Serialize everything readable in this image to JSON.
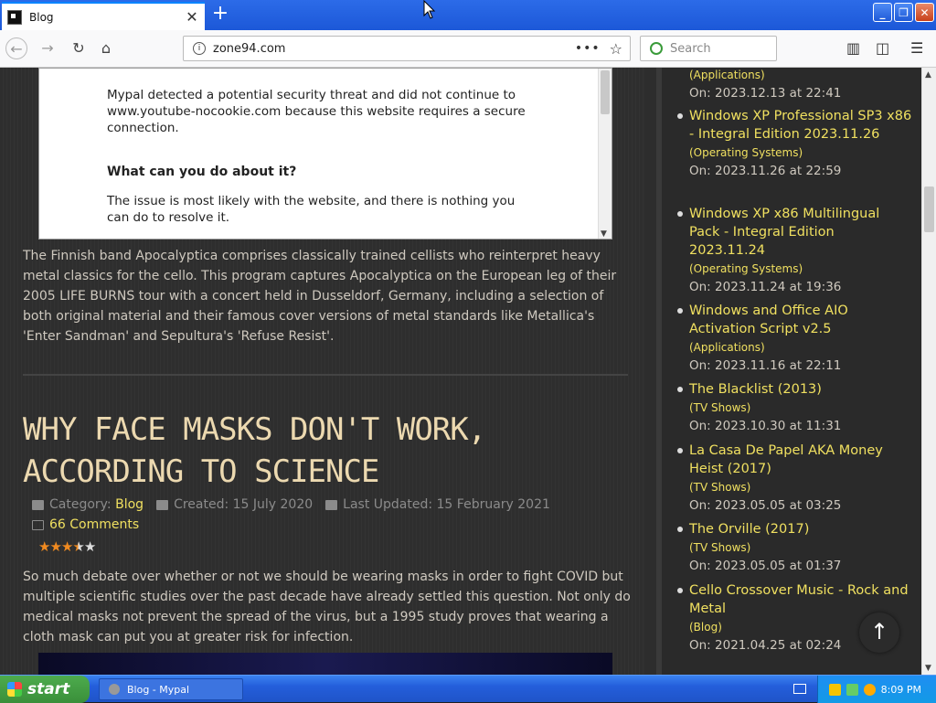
{
  "browser": {
    "tab_title": "Blog",
    "url": "zone94.com",
    "search_placeholder": "Search"
  },
  "frame": {
    "line1": "Mypal detected a potential security threat and did not continue to www.youtube-nocookie.com because this website requires a secure connection.",
    "heading": "What can you do about it?",
    "line2": "The issue is most likely with the website, and there is nothing you can do to resolve it."
  },
  "article1": {
    "body": "The Finnish band Apocalyptica comprises classically trained cellists who reinterpret heavy metal classics for the cello. This program captures Apocalyptica on the European leg of their 2005 LIFE BURNS tour with a concert held in Dusseldorf, Germany, including a selection of both original material and their famous cover versions of metal standards like Metallica's 'Enter Sandman' and Sepultura's 'Refuse Resist'."
  },
  "article2": {
    "title": "Why Face Masks Don't Work, According to Science",
    "category_label": "Category:",
    "category": "Blog",
    "created": "Created: 15 July 2020",
    "updated": "Last Updated: 15 February 2021",
    "comments": "66 Comments",
    "rating": 3.5,
    "body": "So much debate over whether or not we should be wearing masks in order to fight COVID but multiple scientific studies over the past decade have already settled this question. Not only do medical masks not prevent the spread of the virus, but a 1995 study proves that wearing a cloth mask can put you at greater risk for infection."
  },
  "sidebar": {
    "top_cat": "(Applications)",
    "top_date": "On: 2023.12.13 at 22:41",
    "items": [
      {
        "title": "Windows XP Professional SP3 x86 - Integral Edition 2023.11.26",
        "cat": "(Operating Systems)",
        "date": "On: 2023.11.26 at 22:59"
      },
      {
        "title": "Windows XP x86 Multilingual Pack - Integral Edition 2023.11.24",
        "cat": "(Operating Systems)",
        "date": "On: 2023.11.24 at 19:36"
      },
      {
        "title": "Windows and Office AIO Activation Script v2.5",
        "cat": "(Applications)",
        "date": "On: 2023.11.16 at 22:11"
      },
      {
        "title": "The Blacklist (2013)",
        "cat": "(TV Shows)",
        "date": "On: 2023.10.30 at 11:31"
      },
      {
        "title": "La Casa De Papel AKA Money Heist (2017)",
        "cat": "(TV Shows)",
        "date": "On: 2023.05.05 at 03:25"
      },
      {
        "title": "The Orville (2017)",
        "cat": "(TV Shows)",
        "date": "On: 2023.05.05 at 01:37"
      },
      {
        "title": "Cello Crossover Music - Rock and Metal",
        "cat": "(Blog)",
        "date": "On: 2021.04.25 at 02:24"
      }
    ]
  },
  "taskbar": {
    "start": "start",
    "task": "Blog - Mypal",
    "clock": "8:09 PM"
  }
}
